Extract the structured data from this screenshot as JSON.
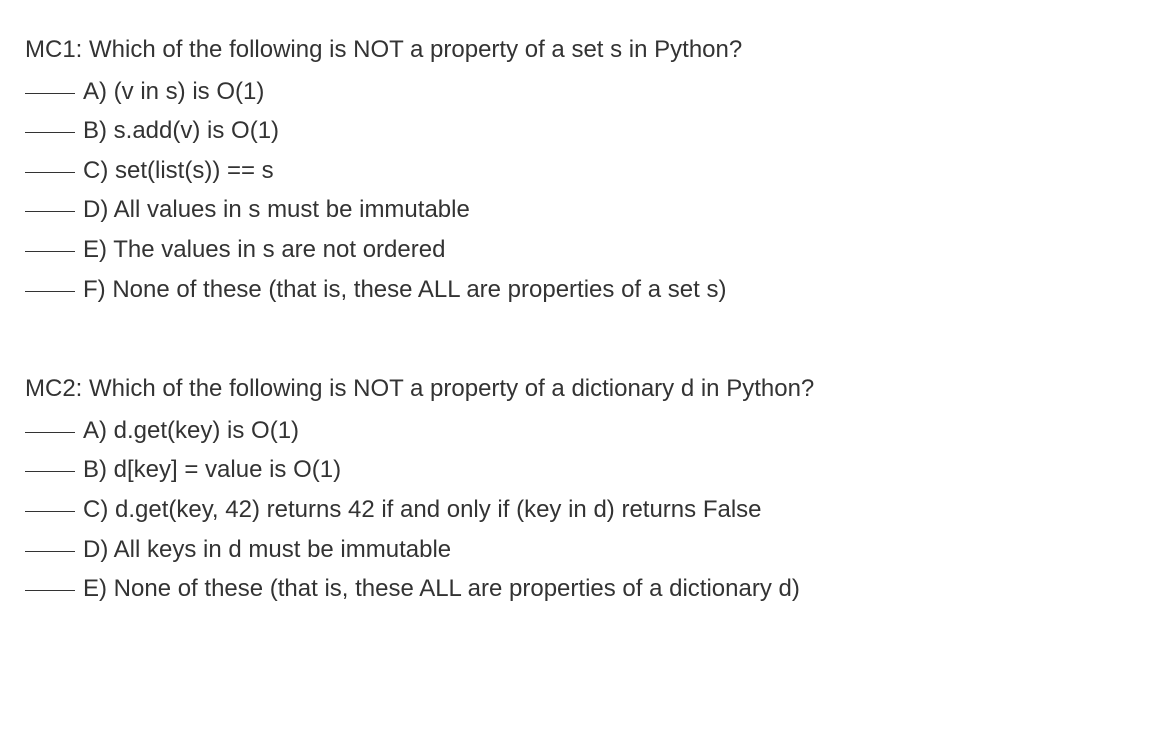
{
  "questions": [
    {
      "id": "MC1",
      "prompt": "MC1: Which of the following is NOT a property of a set s in Python?",
      "options": [
        "A) (v in s) is O(1)",
        "B) s.add(v) is O(1)",
        "C) set(list(s)) == s",
        "D) All values in s must be immutable",
        "E) The values in s are not ordered",
        "F) None of these (that is, these ALL are properties of a set s)"
      ]
    },
    {
      "id": "MC2",
      "prompt": "MC2: Which of the following is NOT a property of a dictionary d in Python?",
      "options": [
        "A) d.get(key) is O(1)",
        "B) d[key] = value is O(1)",
        "C) d.get(key, 42) returns 42 if and only if (key in d) returns False",
        "D) All keys in d must be immutable",
        "E) None of these (that is, these ALL are properties of a dictionary d)"
      ]
    }
  ]
}
